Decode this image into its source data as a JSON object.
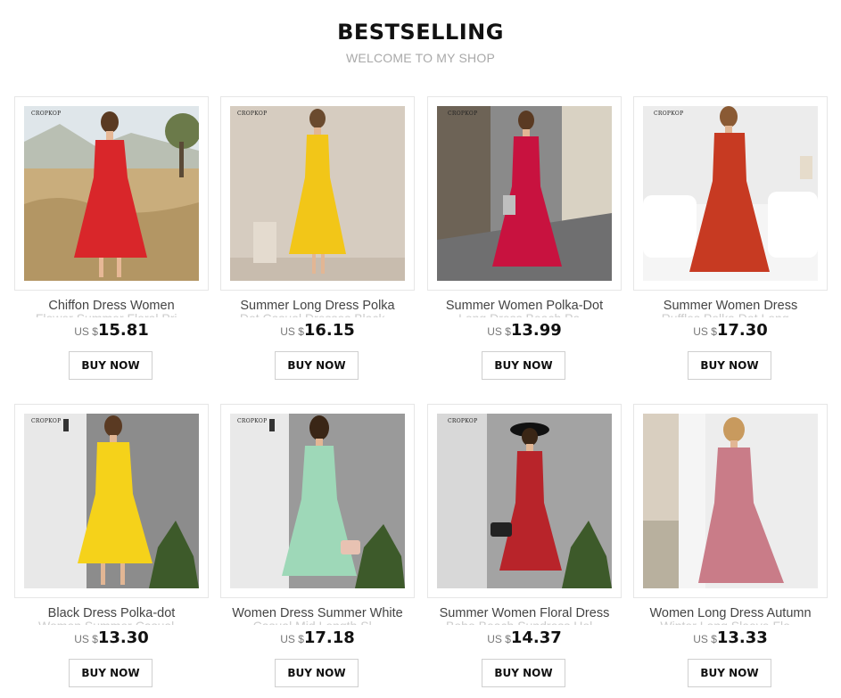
{
  "header": {
    "title": "BESTSELLING",
    "subtitle": "WELCOME TO MY SHOP"
  },
  "products": [
    {
      "name": "Chiffon Dress Women",
      "name_next": "Flower Summer Floral Pri...",
      "currency": "US $",
      "price": "15.81",
      "button": "BUY NOW",
      "brand": "CROPKOP",
      "dress_color": "#d9262a",
      "bg_color": "#c4a878"
    },
    {
      "name": "Summer Long Dress Polka",
      "name_next": "Dot Casual Dresses Black...",
      "currency": "US $",
      "price": "16.15",
      "button": "BUY NOW",
      "brand": "CROPKOP",
      "dress_color": "#f2c618",
      "bg_color": "#d6ccc0"
    },
    {
      "name": "Summer Women Polka-Dot",
      "name_next": "Long Dress Beach Pa...",
      "currency": "US $",
      "price": "13.99",
      "button": "BUY NOW",
      "brand": "CROPKOP",
      "dress_color": "#c8123f",
      "bg_color": "#8a8a8a"
    },
    {
      "name": "Summer Women Dress",
      "name_next": "Ruffles Polka Dot Long...",
      "currency": "US $",
      "price": "17.30",
      "button": "BUY NOW",
      "brand": "CROPKOP",
      "dress_color": "#c73a22",
      "bg_color": "#ececec"
    },
    {
      "name": "Black Dress Polka-dot",
      "name_next": "Women Summer Casual...",
      "currency": "US $",
      "price": "13.30",
      "button": "BUY NOW",
      "brand": "CROPKOP",
      "dress_color": "#f5d21a",
      "bg_color": "#8c8c8c"
    },
    {
      "name": "Women Dress Summer White",
      "name_next": "Casual Mid Length Sl...",
      "currency": "US $",
      "price": "17.18",
      "button": "BUY NOW",
      "brand": "CROPKOP",
      "dress_color": "#9ed8b8",
      "bg_color": "#9a9a9a"
    },
    {
      "name": "Summer Women Floral Dress",
      "name_next": "Boho Beach Sundress Hol...",
      "currency": "US $",
      "price": "14.37",
      "button": "BUY NOW",
      "brand": "CROPKOP",
      "dress_color": "#b8242a",
      "bg_color": "#a3a3a3"
    },
    {
      "name": "Women Long Dress Autumn",
      "name_next": "Winter Long Sleeve Flo...",
      "currency": "US $",
      "price": "13.33",
      "button": "BUY NOW",
      "brand": "",
      "dress_color": "#c97c88",
      "bg_color": "#ededed"
    }
  ]
}
